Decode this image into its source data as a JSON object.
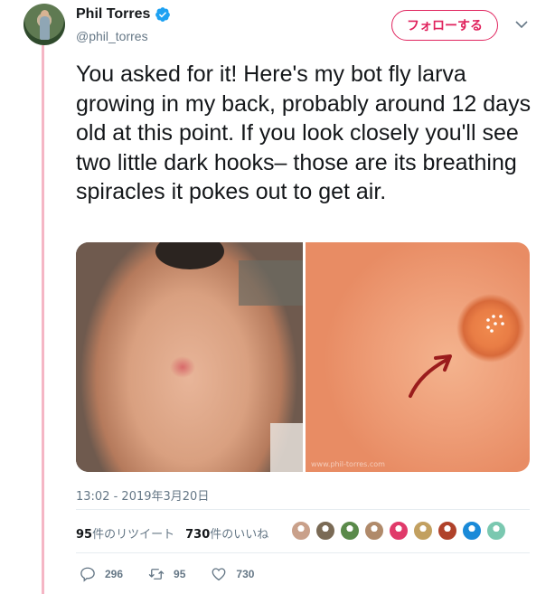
{
  "author": {
    "name": "Phil Torres",
    "handle": "@phil_torres",
    "verified": true
  },
  "header": {
    "follow_label": "フォローする",
    "accent_color": "#e0245e"
  },
  "tweet": {
    "text": "You asked for it! Here's my bot fly larva growing in my back, probably around 12 days old at this point. If you look closely you'll see two little dark hooks– those are its breathing spiracles it pokes out to get air.",
    "timestamp": "13:02 - 2019年3月20日"
  },
  "media": {
    "count": 2,
    "watermark": "www.phil-torres.com"
  },
  "stats": {
    "retweets_count": "95",
    "retweets_suffix": "件のリツイート",
    "likes_count": "730",
    "likes_suffix": "件のいいね"
  },
  "likers": {
    "avatar_colors": [
      "#c9a08a",
      "#7a6a55",
      "#5a8a4a",
      "#b08a6a",
      "#e03a6a",
      "#c2a060",
      "#b0422a",
      "#1a8ad8",
      "#7ac8b0"
    ]
  },
  "actions": {
    "reply_count": "296",
    "retweet_count": "95",
    "like_count": "730"
  },
  "icons": {
    "verified": "verified-badge-icon",
    "caret": "chevron-down-icon",
    "reply": "reply-icon",
    "retweet": "retweet-icon",
    "like": "heart-icon"
  }
}
